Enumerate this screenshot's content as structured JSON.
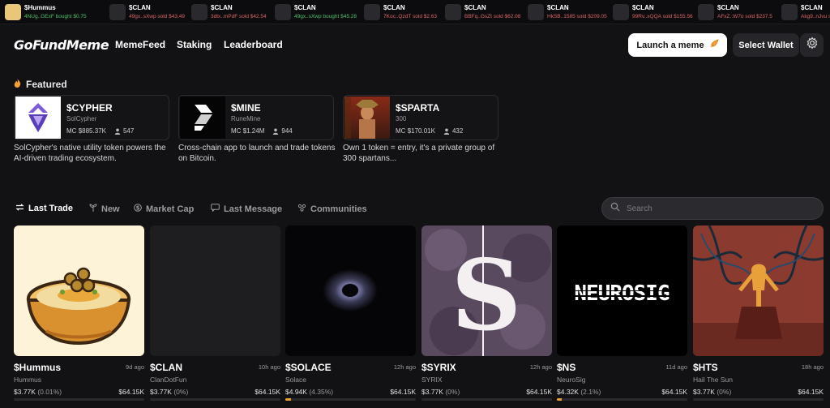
{
  "ticker": [
    {
      "symbol": "$Hummus",
      "action": "4NUg..GExF bought $0.75",
      "type": "buy",
      "thumb": "#e8c77a"
    },
    {
      "symbol": "$CLAN",
      "action": "49gx..sXwp sold $43.49",
      "type": "sell",
      "thumb": "#2a2a2e"
    },
    {
      "symbol": "$CLAN",
      "action": "3dtx..mPdF sold $42.54",
      "type": "sell",
      "thumb": "#2a2a2e"
    },
    {
      "symbol": "$CLAN",
      "action": "49gx..sXwp bought $45.28",
      "type": "buy",
      "thumb": "#2a2a2e"
    },
    {
      "symbol": "$CLAN",
      "action": "7Koc..QzdT sold $2.63",
      "type": "sell",
      "thumb": "#2a2a2e"
    },
    {
      "symbol": "$CLAN",
      "action": "BBFq..GsZt sold $62.08",
      "type": "sell",
      "thumb": "#2a2a2e"
    },
    {
      "symbol": "$CLAN",
      "action": "HkSB..1585 sold $209.05",
      "type": "sell",
      "thumb": "#2a2a2e"
    },
    {
      "symbol": "$CLAN",
      "action": "99Rv..xQQA sold $155.56",
      "type": "sell",
      "thumb": "#2a2a2e"
    },
    {
      "symbol": "$CLAN",
      "action": "AFxZ..W7o sold $237.5",
      "type": "sell",
      "thumb": "#2a2a2e"
    },
    {
      "symbol": "$CLAN",
      "action": "Akg9..nJvu sold $9",
      "type": "sell",
      "thumb": "#2a2a2e"
    }
  ],
  "header": {
    "logo": "GoFundMeme",
    "nav": [
      "MemeFeed",
      "Staking",
      "Leaderboard"
    ],
    "launch_label": "Launch a meme",
    "wallet_label": "Select Wallet",
    "settings_icon": "gear-icon"
  },
  "featured": {
    "title": "Featured",
    "title_icon": "flame-icon",
    "cards": [
      {
        "symbol": "$CYPHER",
        "name": "SolCypher",
        "mc_label": "MC",
        "mc": "$885.37K",
        "holders": "547",
        "desc": "SolCypher's native utility token powers the AI-driven trading ecosystem."
      },
      {
        "symbol": "$MINE",
        "name": "RuneMine",
        "mc_label": "MC",
        "mc": "$1.24M",
        "holders": "944",
        "desc": "Cross-chain app to launch and trade tokens on Bitcoin."
      },
      {
        "symbol": "$SPARTA",
        "name": "300",
        "mc_label": "MC",
        "mc": "$170.01K",
        "holders": "432",
        "desc": "Own 1 token = entry, it's a private group of 300 spartans..."
      }
    ]
  },
  "tabs": [
    {
      "label": "Last Trade",
      "icon": "arrows-swap-icon",
      "active": true
    },
    {
      "label": "New",
      "icon": "sprout-icon",
      "active": false
    },
    {
      "label": "Market Cap",
      "icon": "dollar-circle-icon",
      "active": false
    },
    {
      "label": "Last Message",
      "icon": "message-icon",
      "active": false
    },
    {
      "label": "Communities",
      "icon": "community-icon",
      "active": false
    }
  ],
  "search": {
    "placeholder": "Search",
    "value": ""
  },
  "tokens": [
    {
      "symbol": "$Hummus",
      "name": "Hummus",
      "ago": "9d ago",
      "mc": "$3.77K",
      "change": "(0.01%)",
      "goal": "$64.15K",
      "progress": 0.0
    },
    {
      "symbol": "$CLAN",
      "name": "ClanDotFun",
      "ago": "10h ago",
      "mc": "$3.77K",
      "change": "(0%)",
      "goal": "$64.15K",
      "progress": 0.0
    },
    {
      "symbol": "$SOLACE",
      "name": "Solace",
      "ago": "12h ago",
      "mc": "$4.94K",
      "change": "(4.35%)",
      "goal": "$64.15K",
      "progress": 0.0435
    },
    {
      "symbol": "$SYRIX",
      "name": "SYRIX",
      "ago": "12h ago",
      "mc": "$3.77K",
      "change": "(0%)",
      "goal": "$64.15K",
      "progress": 0.0
    },
    {
      "symbol": "$NS",
      "name": "NeuroSig",
      "ago": "11d ago",
      "mc": "$4.32K",
      "change": "(2.1%)",
      "goal": "$64.15K",
      "progress": 0.021
    },
    {
      "symbol": "$HTS",
      "name": "Hail The Sun",
      "ago": "18h ago",
      "mc": "$3.77K",
      "change": "(0%)",
      "goal": "$64.15K",
      "progress": 0.0
    }
  ],
  "images": {
    "ns_wordmark": "NEUROSIG",
    "syrix_glyph": "S"
  },
  "colors": {
    "accent": "#e8a22c",
    "sell": "#dd6666",
    "buy": "#4fc36b",
    "bg": "#121214"
  }
}
